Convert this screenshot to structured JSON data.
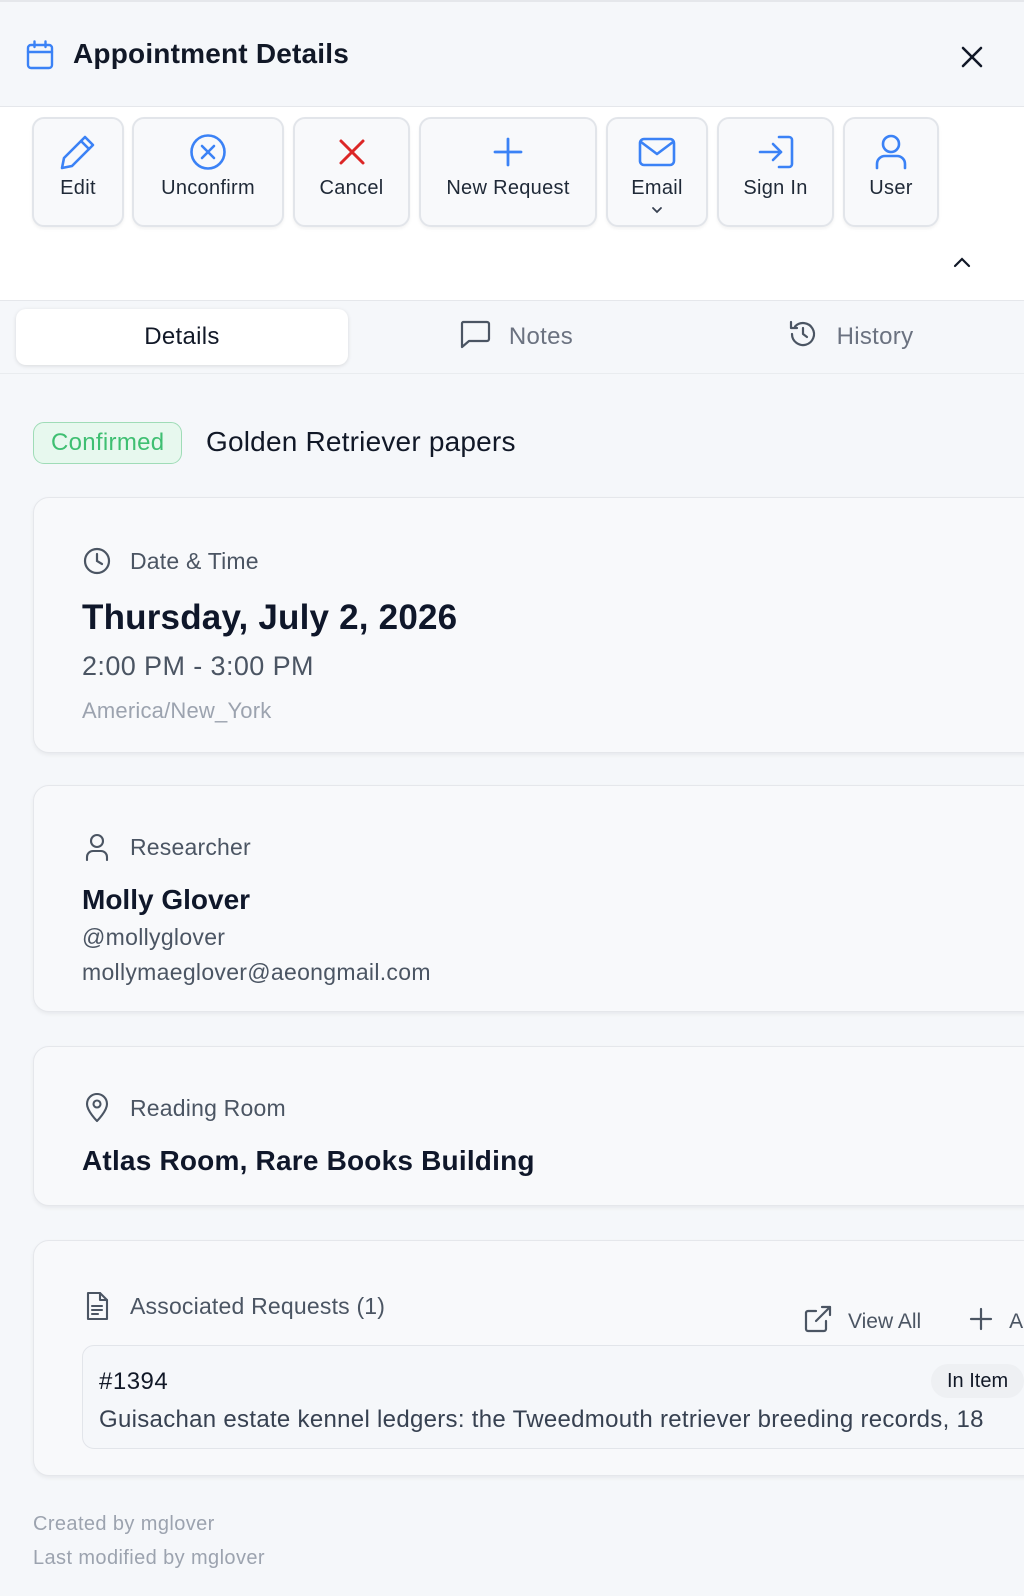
{
  "header": {
    "title": "Appointment Details",
    "icon": "calendar-icon",
    "close_icon": "close-icon"
  },
  "toolbar": {
    "buttons": [
      {
        "label": "Edit",
        "icon": "pencil-icon"
      },
      {
        "label": "Unconfirm",
        "icon": "x-circle-icon"
      },
      {
        "label": "Cancel",
        "icon": "x-icon"
      },
      {
        "label": "New Request",
        "icon": "plus-icon"
      },
      {
        "label": "Email",
        "icon": "mail-icon"
      },
      {
        "label": "Sign In",
        "icon": "sign-in-icon"
      },
      {
        "label": "User",
        "icon": "user-icon"
      }
    ]
  },
  "tabs": [
    {
      "label": "Details",
      "active": true
    },
    {
      "label": "Notes",
      "icon": "message-square-icon"
    },
    {
      "label": "History",
      "icon": "history-icon"
    }
  ],
  "appointment": {
    "status": "Confirmed",
    "title": "Golden Retriever papers"
  },
  "datetime": {
    "heading": "Date & Time",
    "date": "Thursday, July 2, 2026",
    "time": "2:00 PM - 3:00 PM",
    "timezone": "America/New_York"
  },
  "researcher": {
    "heading": "Researcher",
    "name": "Molly Glover",
    "username": "@mollyglover",
    "email": "mollymaeglover@aeongmail.com"
  },
  "room": {
    "heading": "Reading Room",
    "name": "Atlas Room, Rare Books Building"
  },
  "requests": {
    "heading": "Associated Requests (1)",
    "view_all": "View All",
    "add_label": "A",
    "items": [
      {
        "number": "#1394",
        "status": "In Item",
        "description": "Guisachan estate kennel ledgers: the Tweedmouth retriever breeding records, 18"
      }
    ]
  },
  "meta": {
    "created": "Created by mglover",
    "modified": "Last modified by mglover"
  },
  "colors": {
    "accent": "#3b82f6",
    "danger": "#dc2626",
    "success": "#3fbf72"
  }
}
